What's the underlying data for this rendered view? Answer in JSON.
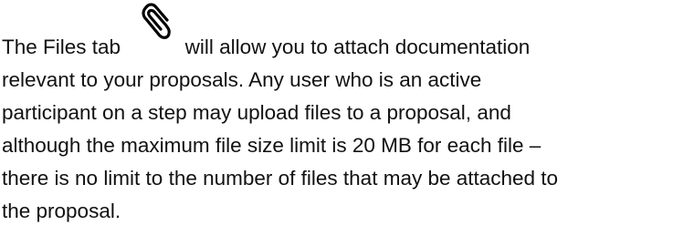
{
  "paragraph": {
    "line_1_before_icon": "The Files tab",
    "icon": "paperclip-icon",
    "line_1_after_icon": "will allow you to attach documentation",
    "line_2": "relevant to your proposals. Any user who is an active",
    "line_3": "participant on a step may upload files to a proposal, and",
    "line_4": "although the maximum file size limit is 20 MB for each file –",
    "line_5": "there is no limit to the number of files that may be attached to",
    "line_6": "the proposal."
  },
  "colors": {
    "text": "#111111",
    "icon_stroke": "#000000",
    "background": "#ffffff"
  }
}
